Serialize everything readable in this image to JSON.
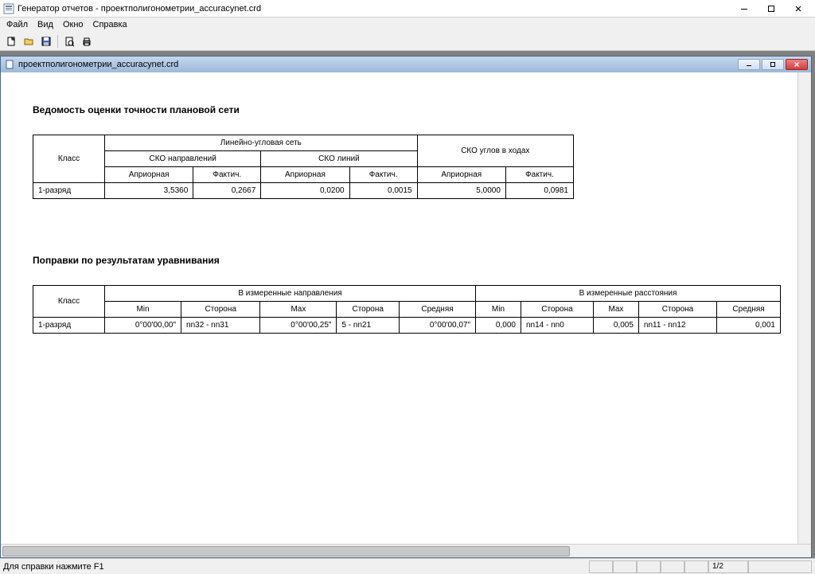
{
  "window": {
    "title": "Генератор отчетов - проектполигонометрии_accuracynet.crd"
  },
  "menu": {
    "file": "Файл",
    "view": "Вид",
    "window": "Окно",
    "help": "Справка"
  },
  "document": {
    "title": "проектполигонометрии_accuracynet.crd"
  },
  "section1": {
    "title": "Ведомость оценки точности плановой сети"
  },
  "t1": {
    "h_class": "Класс",
    "h_linang": "Линейно-угловая сеть",
    "h_sko_angles": "СКО углов в ходах",
    "h_sko_dir": "СКО направлений",
    "h_sko_line": "СКО линий",
    "h_apriori": "Априорная",
    "h_fact": "Фактич.",
    "r0_class": "1-разряд",
    "r0_dir_ap": "3,5360",
    "r0_dir_fc": "0,2667",
    "r0_lin_ap": "0,0200",
    "r0_lin_fc": "0,0015",
    "r0_ang_ap": "5,0000",
    "r0_ang_fc": "0,0981"
  },
  "section2": {
    "title": "Поправки по результатам уравнивания"
  },
  "t2": {
    "h_class": "Класс",
    "h_meas_dir": "В измеренные направления",
    "h_meas_dist": "В измеренные расстояния",
    "h_min": "Min",
    "h_side": "Сторона",
    "h_max": "Max",
    "h_avg": "Средняя",
    "r0_class": "1-разряд",
    "r0_d_min": "0°00'00,00\"",
    "r0_d_min_side": "nn32 - nn31",
    "r0_d_max": "0°00'00,25\"",
    "r0_d_max_side": "5 - nn21",
    "r0_d_avg": "0°00'00,07\"",
    "r0_s_min": "0,000",
    "r0_s_min_side": "nn14 - nn0",
    "r0_s_max": "0,005",
    "r0_s_max_side": "nn11 - nn12",
    "r0_s_avg": "0,001"
  },
  "status": {
    "help": "Для справки нажмите  F1",
    "page": "1/2"
  }
}
